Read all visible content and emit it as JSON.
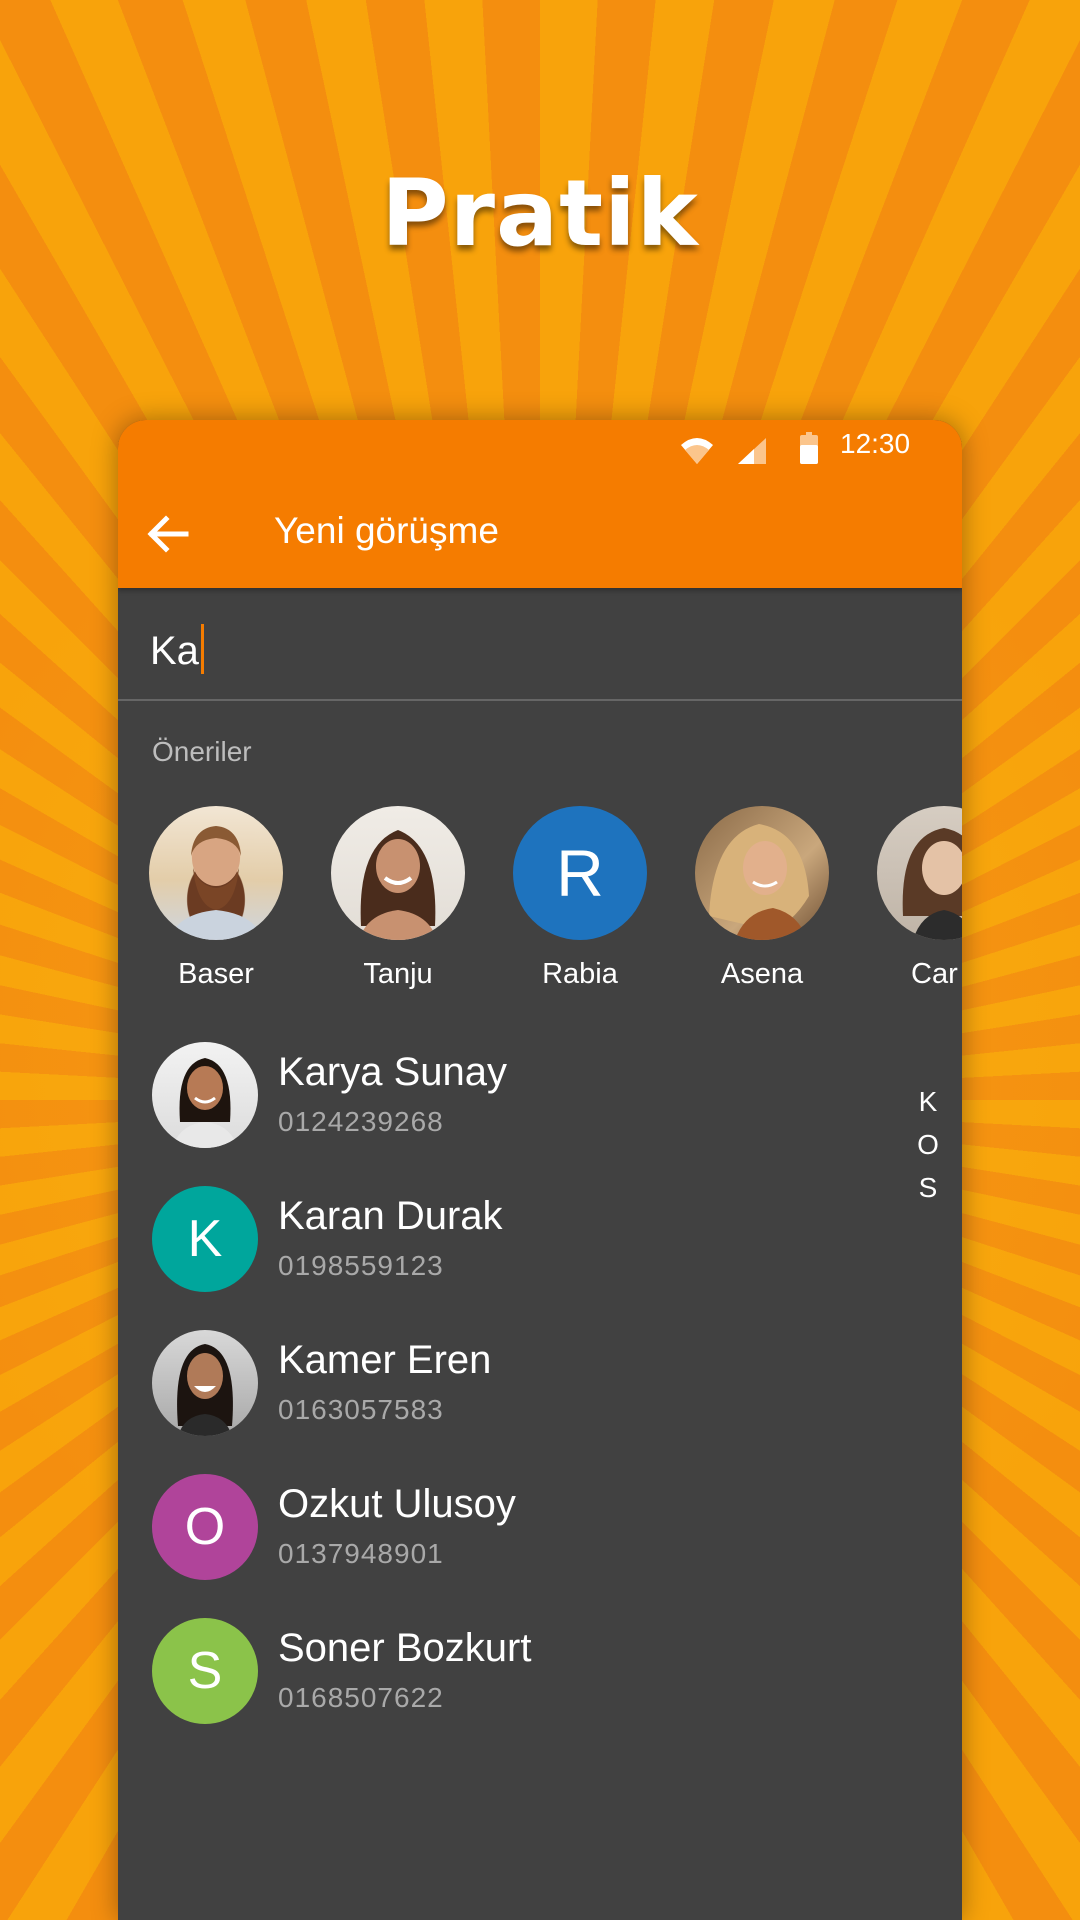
{
  "headline": "Pratik",
  "status": {
    "time": "12:30",
    "wifi_icon": "wifi-icon",
    "signal_icon": "signal-icon",
    "battery_icon": "battery-icon"
  },
  "toolbar": {
    "back_icon": "arrow-left-icon",
    "title": "Yeni görüşme"
  },
  "search": {
    "value": "Ka"
  },
  "suggestions": {
    "label": "Öneriler",
    "items": [
      {
        "name": "Baser",
        "avatar": "photo"
      },
      {
        "name": "Tanju",
        "avatar": "photo"
      },
      {
        "name": "Rabia",
        "avatar": "letter",
        "letter": "R",
        "color": "#1e73be"
      },
      {
        "name": "Asena",
        "avatar": "photo"
      },
      {
        "name": "Car",
        "avatar": "photo"
      }
    ]
  },
  "contacts": [
    {
      "name": "Karya Sunay",
      "phone": "0124239268",
      "avatar": "photo"
    },
    {
      "name": "Karan Durak",
      "phone": "0198559123",
      "avatar": "letter",
      "letter": "K",
      "color": "#00a69c"
    },
    {
      "name": "Kamer Eren",
      "phone": "0163057583",
      "avatar": "photo"
    },
    {
      "name": "Ozkut Ulusoy",
      "phone": "0137948901",
      "avatar": "letter",
      "letter": "O",
      "color": "#b0449a"
    },
    {
      "name": "Soner Bozkurt",
      "phone": "0168507622",
      "avatar": "letter",
      "letter": "S",
      "color": "#8bc34a"
    }
  ],
  "index_letters": [
    "K",
    "O",
    "S"
  ],
  "colors": {
    "accent": "#f57c00",
    "surface": "#414141"
  }
}
